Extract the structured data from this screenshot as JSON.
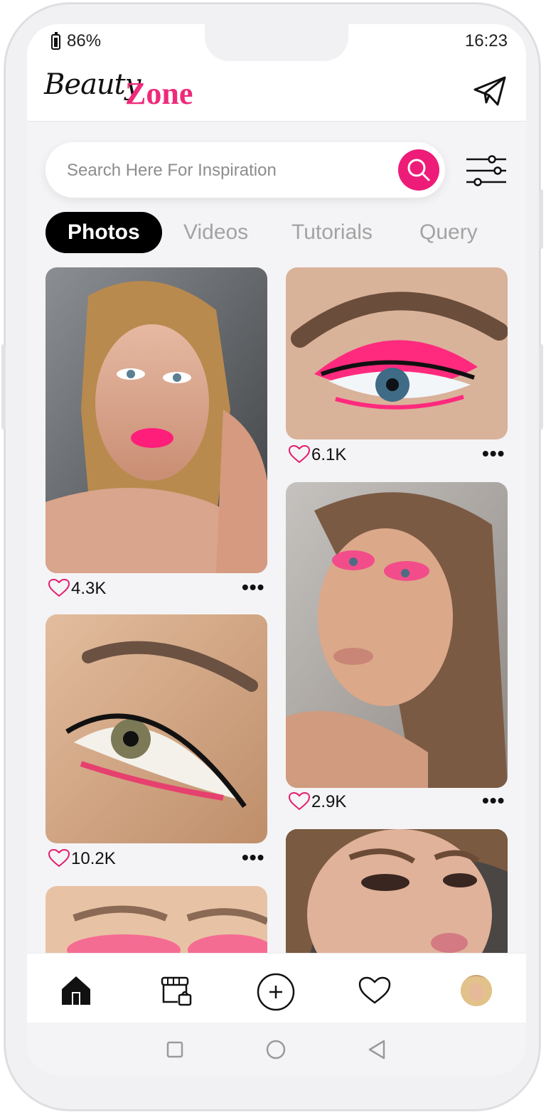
{
  "status_bar": {
    "battery": "86%",
    "time": "16:23"
  },
  "header": {
    "logo_script": "Beauty",
    "logo_bold": "Zone",
    "send_icon": "paper-plane-icon"
  },
  "search": {
    "placeholder": "Search Here For Inspiration",
    "button_icon": "search-icon",
    "filter_icon": "sliders-icon"
  },
  "tabs": [
    {
      "label": "Photos",
      "active": true
    },
    {
      "label": "Videos",
      "active": false
    },
    {
      "label": "Tutorials",
      "active": false
    },
    {
      "label": "Query",
      "active": false
    }
  ],
  "feed": {
    "left": [
      {
        "likes": "4.3K"
      },
      {
        "likes": "10.2K"
      },
      {
        "likes": ""
      }
    ],
    "right": [
      {
        "likes": "6.1K"
      },
      {
        "likes": "2.9K"
      },
      {
        "likes": ""
      }
    ]
  },
  "bottom_nav": [
    {
      "icon": "home-icon"
    },
    {
      "icon": "shop-icon"
    },
    {
      "icon": "add-icon"
    },
    {
      "icon": "heart-icon"
    },
    {
      "icon": "avatar"
    }
  ],
  "system_nav": [
    "square-icon",
    "circle-icon",
    "back-triangle-icon"
  ],
  "colors": {
    "accent": "#ee1c79",
    "active_tab": "#000000",
    "inactive_tab": "#a3a3a3"
  }
}
